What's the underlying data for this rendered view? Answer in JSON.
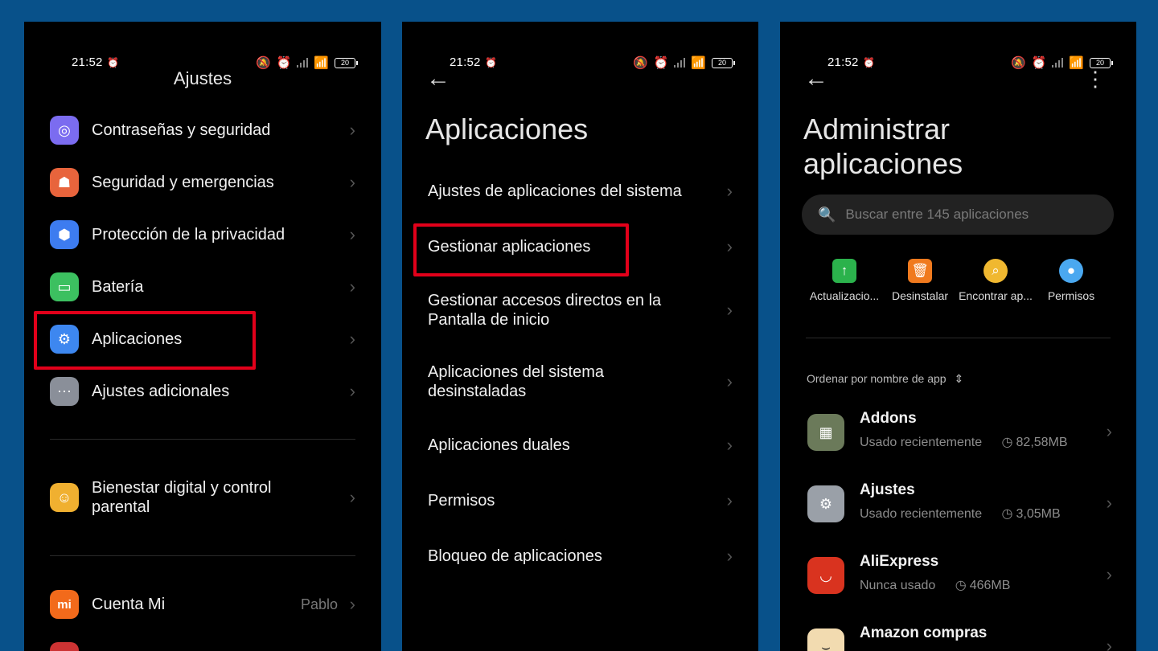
{
  "status": {
    "time": "21:52",
    "battery": "20"
  },
  "screen1": {
    "title": "Ajustes",
    "items": [
      {
        "label": "Contraseñas y seguridad",
        "icon": "fingerprint-icon",
        "color": "#7b6cf0"
      },
      {
        "label": "Seguridad y emergencias",
        "icon": "emergency-icon",
        "color": "#e8643c"
      },
      {
        "label": "Protección de la privacidad",
        "icon": "privacy-shield-icon",
        "color": "#3d7cf0"
      },
      {
        "label": "Batería",
        "icon": "battery-icon",
        "color": "#3cc060"
      },
      {
        "label": "Aplicaciones",
        "icon": "gear-icon",
        "color": "#3d87f0"
      },
      {
        "label": "Ajustes adicionales",
        "icon": "more-dots-icon",
        "color": "#8a8f99"
      }
    ],
    "wellbeing": {
      "line1": "Bienestar digital y control",
      "line2": "parental",
      "icon": "wellbeing-icon",
      "color": "#f0b030"
    },
    "account": {
      "label": "Cuenta Mi",
      "value": "Pablo",
      "icon": "mi-logo-icon",
      "color": "#f26a1b"
    }
  },
  "screen2": {
    "title": "Aplicaciones",
    "items": [
      {
        "line1": "Ajustes de aplicaciones del sistema"
      },
      {
        "line1": "Gestionar aplicaciones"
      },
      {
        "line1": "Gestionar accesos directos en la",
        "line2": "Pantalla de inicio"
      },
      {
        "line1": "Aplicaciones del sistema",
        "line2": "desinstaladas"
      },
      {
        "line1": "Aplicaciones duales"
      },
      {
        "line1": "Permisos"
      },
      {
        "line1": "Bloqueo de aplicaciones"
      }
    ]
  },
  "screen3": {
    "title_line1": "Administrar",
    "title_line2": "aplicaciones",
    "search_placeholder": "Buscar entre 145 aplicaciones",
    "actions": [
      {
        "label": "Actualizacio...",
        "icon": "update-icon",
        "color": "#2bb24c"
      },
      {
        "label": "Desinstalar",
        "icon": "trash-icon",
        "color": "#f07a1e"
      },
      {
        "label": "Encontrar ap...",
        "icon": "find-apps-icon",
        "color": "#f0b830"
      },
      {
        "label": "Permisos",
        "icon": "permissions-icon",
        "color": "#4aa8f0"
      }
    ],
    "sort_label": "Ordenar por nombre de app",
    "apps": [
      {
        "name": "Addons",
        "usage": "Usado recientemente",
        "size": "82,58MB",
        "icon": "addons-app-icon",
        "color": "#6b7a5a"
      },
      {
        "name": "Ajustes",
        "usage": "Usado recientemente",
        "size": "3,05MB",
        "icon": "settings-app-icon",
        "color": "#9aa0a8"
      },
      {
        "name": "AliExpress",
        "usage": "Nunca usado",
        "size": "466MB",
        "icon": "aliexpress-app-icon",
        "color": "#d9331f"
      },
      {
        "name": "Amazon compras",
        "icon": "amazon-app-icon",
        "color": "#f2dbb0"
      }
    ]
  }
}
